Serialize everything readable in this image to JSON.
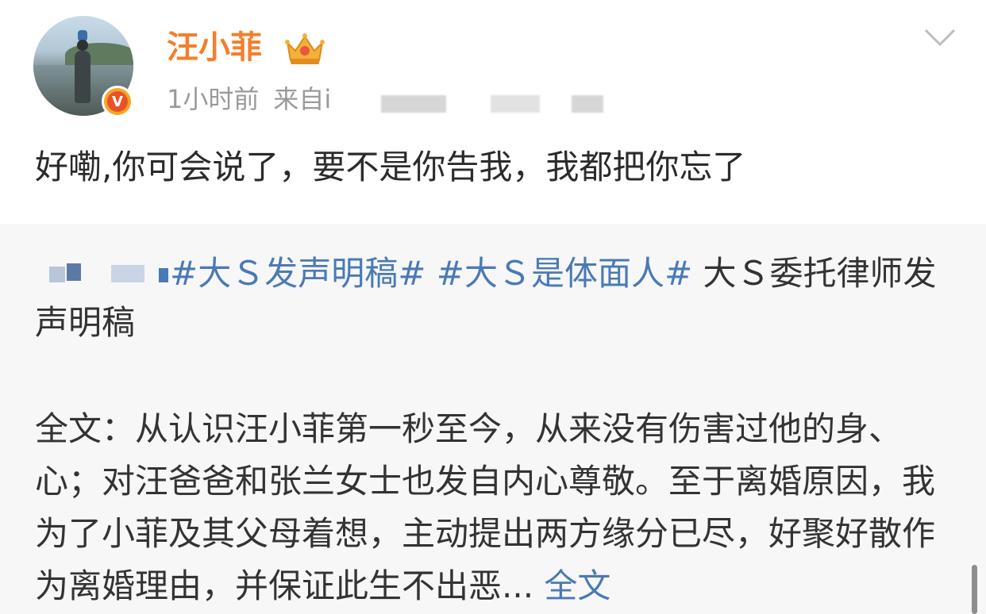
{
  "post": {
    "username": "汪小菲",
    "time": "1小时前",
    "source_prefix": "来自i",
    "text": "好嘞,你可会说了，要不是你告我，我都把你忘了",
    "verified_badge": "V",
    "icons": {
      "level_badge": "crown-icon",
      "menu": "chevron-down-icon",
      "verified": "verified-badge-icon"
    }
  },
  "repost": {
    "hashtags": [
      "#大Ｓ发声明稿#",
      "#大Ｓ是体面人#"
    ],
    "headline": "大Ｓ委托律师发声明稿",
    "body": "全文：从认识汪小菲第一秒至今，从来没有伤害过他的身、心；对汪爸爸和张兰女士也发自内心尊敬。至于离婚原因，我为了小菲及其父母着想，主动提出两方缘分已尽，好聚好散作为离婚理由，并保证此生不出恶...",
    "more_link": "全文"
  },
  "colors": {
    "username": "#f37f2d",
    "link": "#4a7ab5",
    "meta": "#9a9a9a",
    "repost_bg": "#f7f7f7"
  }
}
